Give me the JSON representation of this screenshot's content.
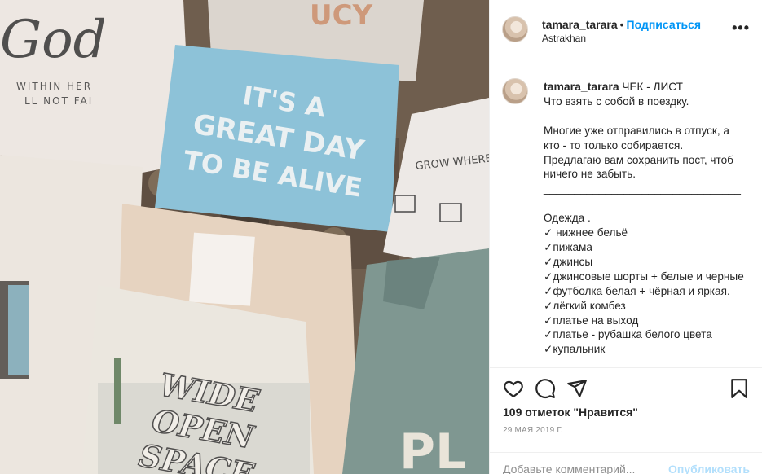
{
  "post": {
    "username": "tamara_tarara",
    "separator": "•",
    "follow_label": "Подписаться",
    "location": "Astrakhan",
    "more_label": "•••"
  },
  "caption": {
    "username": "tamara_tarara",
    "title": "ЧЕК - ЛИСТ",
    "lines": [
      "Что взять с собой в поездку.",
      "",
      "Многие уже отправились в отпуск, а кто - то только собирается.",
      "Предлагаю вам сохранить пост, чтоб ничего не забыть.",
      "________________________________",
      "",
      "Одежда .",
      "✓ нижнее бельё",
      "✓пижама",
      "✓джинсы",
      "✓джинсовые шорты + белые и черные",
      "✓футболка белая + чёрная и яркая.",
      "✓лёгкий комбез",
      "✓платье на выход",
      "✓платье - рубашка белого цвета",
      "✓купальник"
    ]
  },
  "photo": {
    "shirt_text_1": [
      "IT'S A",
      "GREAT DAY",
      "TO BE ALIVE"
    ],
    "shirt_text_2": [
      "WIDE",
      "OPEN",
      "SPACE"
    ],
    "shirt_text_3": "God",
    "shirt_text_3b": [
      "WITHIN HER",
      "LL NOT FAI"
    ],
    "shirt_text_4": "GROW WHERE",
    "shirt_text_5": "UCY",
    "shirt_text_6": "PL"
  },
  "actions": {
    "likes": "109 отметок \"Нравится\"",
    "date": "29 МАЯ 2019 Г.",
    "icons": [
      "heart-icon",
      "comment-icon",
      "share-icon",
      "bookmark-icon"
    ]
  },
  "comment": {
    "placeholder": "Добавьте комментарий...",
    "publish_label": "Опубликовать"
  },
  "colors": {
    "accent": "#0095f6",
    "publish_disabled": "#b2dffc",
    "border": "#efefef",
    "muted": "#8e8e8e"
  }
}
